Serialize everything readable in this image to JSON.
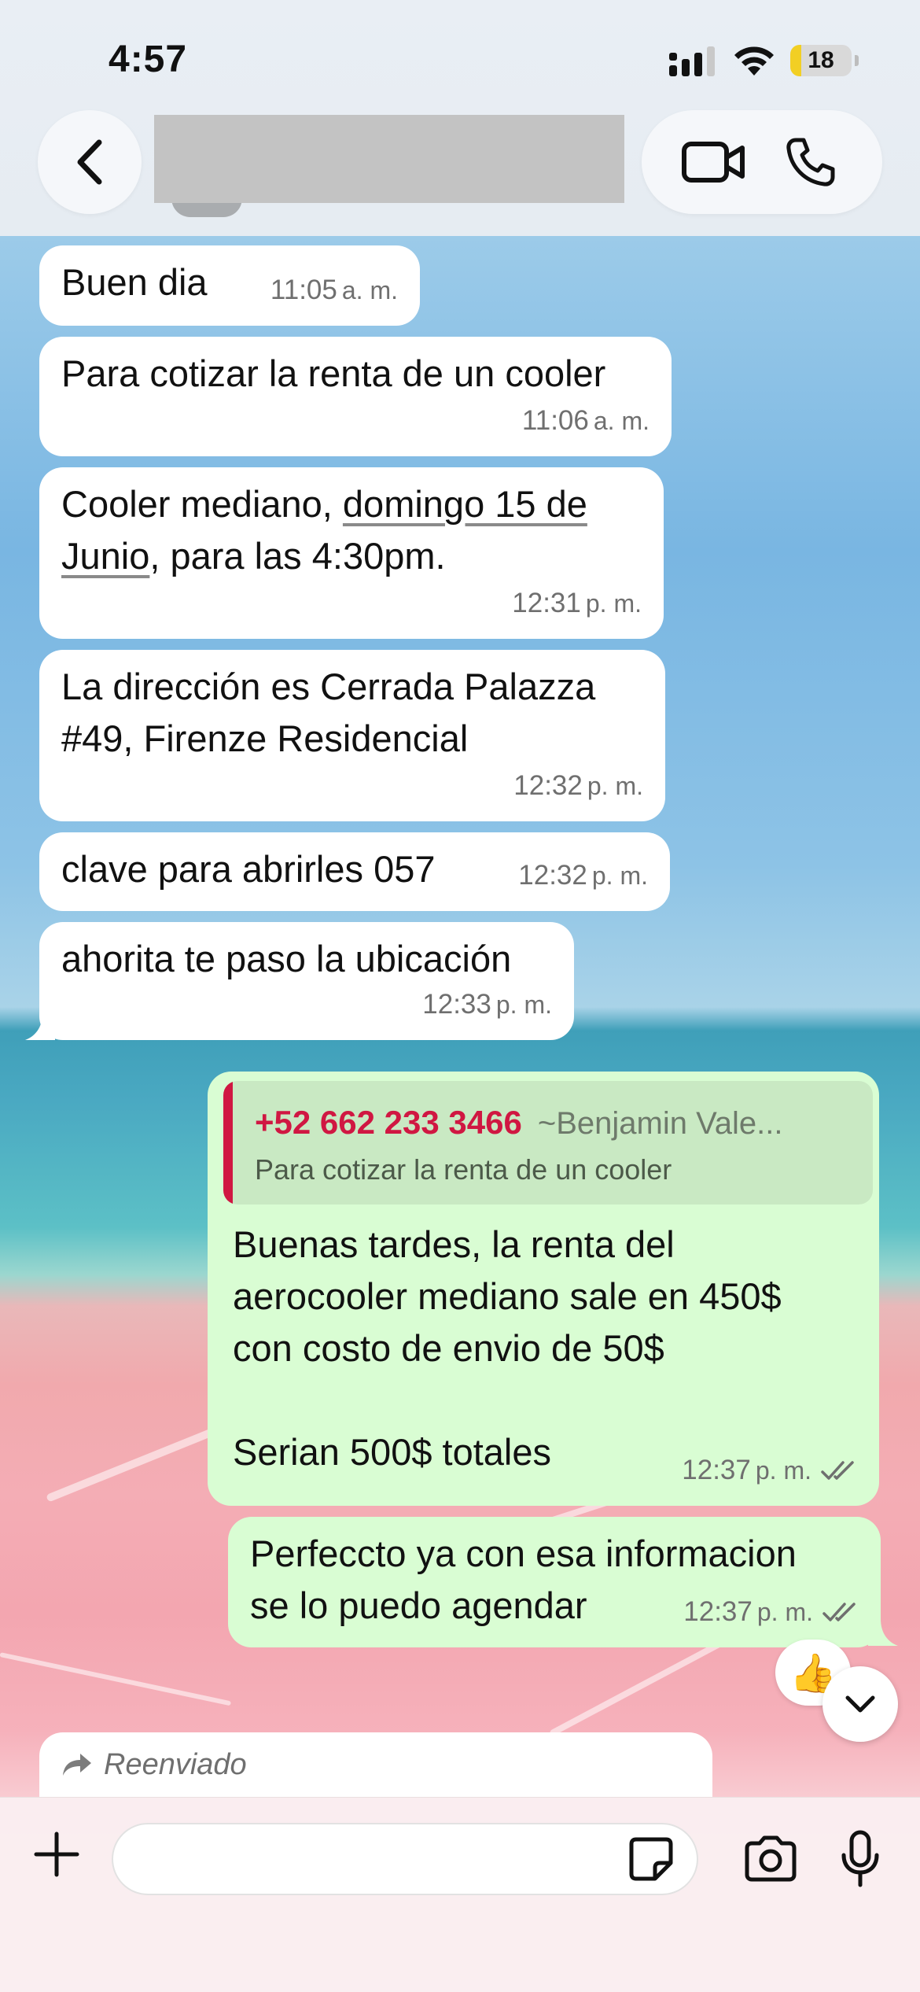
{
  "status_bar": {
    "time": "4:57",
    "battery": "18",
    "battery_level": 0.18
  },
  "header": {
    "contact_name": ""
  },
  "messages": [
    {
      "direction": "in",
      "text": "Buen dia",
      "time": "11:05",
      "ampm": "a. m."
    },
    {
      "direction": "in",
      "text": "Para cotizar la renta de un cooler",
      "time": "11:06",
      "ampm": "a. m."
    },
    {
      "direction": "in",
      "text_before": "Cooler mediano, ",
      "text_link1": "domingo 15 de",
      "text_link2": "Junio",
      "text_after": ", para las 4:30pm.",
      "time": "12:31",
      "ampm": "p. m."
    },
    {
      "direction": "in",
      "text": "La dirección es Cerrada Palazza\n#49, Firenze Residencial",
      "time": "12:32",
      "ampm": "p. m."
    },
    {
      "direction": "in",
      "text": "clave para abrirles 057",
      "time": "12:32",
      "ampm": "p. m."
    },
    {
      "direction": "in",
      "text": "ahorita te paso la ubicación",
      "time": "12:33",
      "ampm": "p. m."
    },
    {
      "direction": "out",
      "quote": {
        "phone": "+52 662 233 3466",
        "sender": "~Benjamin Vale...",
        "text": "Para cotizar la renta de un cooler"
      },
      "text": "Buenas tardes, la renta del\naerocooler mediano sale en 450$\ncon costo de envio de 50$\n\nSerian 500$ totales",
      "time": "12:37",
      "ampm": "p. m."
    },
    {
      "direction": "out",
      "text": "Perfeccto ya con esa informacion\nse lo puedo agendar",
      "time": "12:37",
      "ampm": "p. m.",
      "reaction": "👍"
    }
  ],
  "forwarded": {
    "label": "Reenviado"
  },
  "icons": {
    "back": "chevron-left-icon",
    "video": "video-camera-icon",
    "phone": "phone-icon",
    "plus": "plus-icon",
    "sticker": "sticker-icon",
    "camera": "camera-icon",
    "mic": "microphone-icon",
    "scroll": "chevron-down-icon",
    "forward": "forward-arrow-icon",
    "read": "double-check-icon"
  },
  "colors": {
    "incoming": "#ffffff",
    "outgoing": "#d9fdd3",
    "quote_accent": "#d01742",
    "battery": "#f2cf24"
  }
}
